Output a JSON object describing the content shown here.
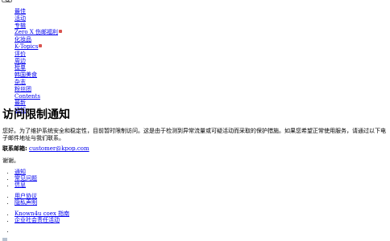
{
  "nav": {
    "items": [
      {
        "label": "最佳"
      },
      {
        "label": "活动"
      },
      {
        "label": "专辑"
      },
      {
        "label": "Zero X 伤邮福利",
        "badge": true
      },
      {
        "label": "化妆品"
      },
      {
        "label": "K-Topics",
        "badge": true
      },
      {
        "label": "评价"
      },
      {
        "label": "周边"
      },
      {
        "label": "榜单"
      },
      {
        "label": "韩国美食"
      },
      {
        "label": "杂志"
      },
      {
        "label": "粉丝团"
      },
      {
        "label": "Contents"
      },
      {
        "label": "最新"
      },
      {
        "label": "通知"
      }
    ]
  },
  "main": {
    "title": "访问限制通知",
    "message": "您好。为了维护系统安全和稳定性，目前暂时限制访问。这是由于检测到异常流量或可疑活动而采取的保护措施。如果您希望正常使用服务，请通过以下电子邮件地址与我们联系。",
    "contact_label": "联系邮箱:",
    "contact_email": "customer@kpop.com",
    "thanks": "谢谢。"
  },
  "footer": {
    "group1": [
      "通知",
      "常见问题",
      "信息"
    ],
    "group2": [
      "用户协议",
      "隐私声明"
    ],
    "group3": [
      "Known4u coex 指南",
      "企业社会责任活动"
    ]
  },
  "icons": {
    "search_button": "search-icon",
    "footer_logo": "logo-icon"
  },
  "colors": {
    "link": "#0000ee",
    "badge": "#d9534f"
  }
}
